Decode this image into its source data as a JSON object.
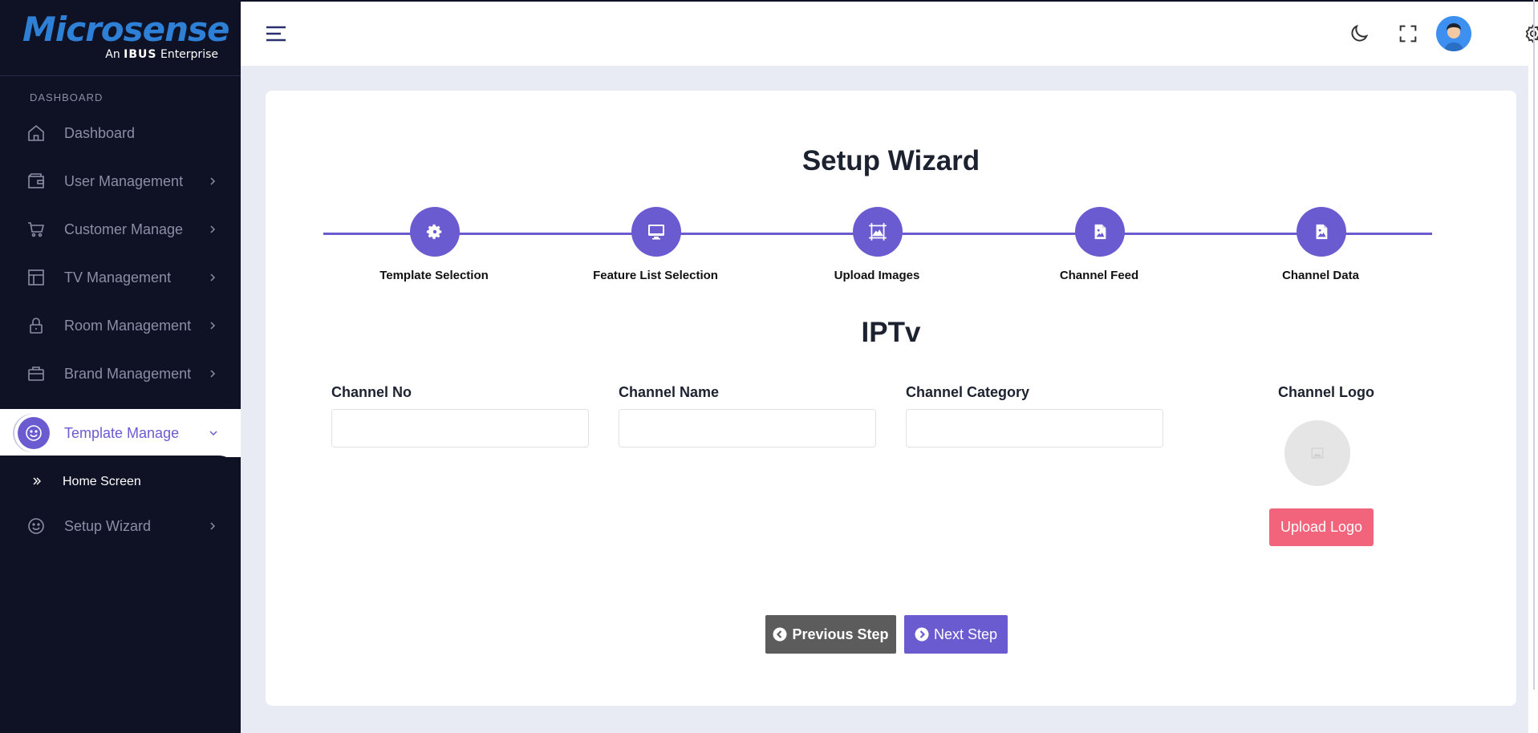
{
  "brand": {
    "name": "Microsense",
    "tagline_prefix": "An",
    "tagline_brand": "IBUS",
    "tagline_suffix": "Enterprise",
    "color": "#2e7fd6"
  },
  "sidebar": {
    "section_label": "DASHBOARD",
    "items": [
      {
        "label": "Dashboard",
        "icon": "home-icon"
      },
      {
        "label": "User Management",
        "icon": "wallet-icon"
      },
      {
        "label": "Customer Manage",
        "icon": "cart-icon"
      },
      {
        "label": "TV Management",
        "icon": "layout-icon"
      },
      {
        "label": "Room Management",
        "icon": "lock-icon"
      },
      {
        "label": "Brand Management",
        "icon": "briefcase-icon"
      }
    ],
    "active_item": {
      "label": "Template Manage",
      "icon": "smile-icon"
    },
    "sub_item": {
      "label": "Home Screen",
      "icon": "chevrons-right-icon"
    },
    "after_item": {
      "label": "Setup Wizard",
      "icon": "smile-icon"
    }
  },
  "topbar": {
    "icons": [
      "menu-icon",
      "moon-icon",
      "fullscreen-icon",
      "avatar",
      "gear-icon"
    ]
  },
  "wizard": {
    "title": "Setup Wizard",
    "steps": [
      {
        "label": "Template Selection",
        "icon": "cog-icon"
      },
      {
        "label": "Feature List Selection",
        "icon": "monitor-icon"
      },
      {
        "label": "Upload Images",
        "icon": "frame-icon"
      },
      {
        "label": "Channel Feed",
        "icon": "image-file-icon"
      },
      {
        "label": "Channel Data",
        "icon": "image-file-icon"
      }
    ],
    "section_title": "IPTv",
    "fields": {
      "channel_no": {
        "label": "Channel No",
        "value": ""
      },
      "channel_name": {
        "label": "Channel Name",
        "value": ""
      },
      "channel_category": {
        "label": "Channel Category",
        "value": ""
      }
    },
    "logo": {
      "label": "Channel Logo",
      "upload_label": "Upload Logo"
    },
    "prev_label": "Previous Step",
    "next_label": "Next Step"
  },
  "colors": {
    "accent": "#6a5bd1",
    "sidebar_bg": "#0f1124",
    "upload_button": "#f2647b",
    "prev_button": "#5c5c5c"
  }
}
